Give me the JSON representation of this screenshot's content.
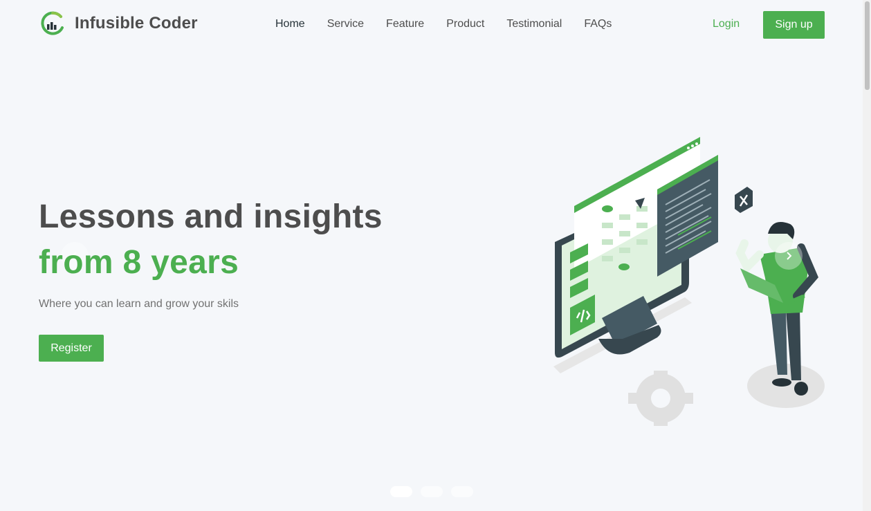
{
  "brand": {
    "name": "Infusible Coder",
    "logo_icon": "chart-circle-logo-icon",
    "accent_color": "#4caf50"
  },
  "nav": {
    "items": [
      {
        "label": "Home"
      },
      {
        "label": "Service"
      },
      {
        "label": "Feature"
      },
      {
        "label": "Product"
      },
      {
        "label": "Testimonial"
      },
      {
        "label": "FAQs"
      }
    ],
    "login_label": "Login",
    "signup_label": "Sign up"
  },
  "hero": {
    "title_line1": "Lessons and insights",
    "title_line2": "from 8 years",
    "subtitle": "Where you can learn and grow your skils",
    "cta_label": "Register",
    "illustration": "developer-coding-illustration",
    "prev_icon": "chevron-left-icon",
    "next_icon": "chevron-right-icon"
  },
  "carousel": {
    "slide_count": 3,
    "active_index": 0
  }
}
